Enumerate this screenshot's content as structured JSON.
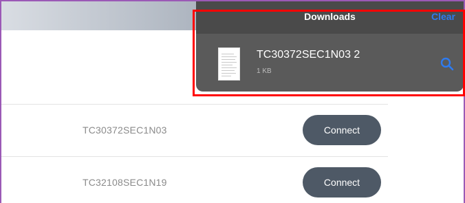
{
  "downloads_panel": {
    "title": "Downloads",
    "clear_label": "Clear",
    "items": [
      {
        "file_name": "TC30372SEC1N03 2",
        "file_size": "1 KB",
        "icon": "search-icon"
      }
    ]
  },
  "devices": [
    {
      "name": "TC30372SEC1N03",
      "action_label": "Connect"
    },
    {
      "name": "TC32108SEC1N19",
      "action_label": "Connect"
    }
  ],
  "colors": {
    "accent": "#2e7bf0",
    "button": "#4e5966",
    "highlight": "#ff0000",
    "popup_bg": "#5a5a5a"
  }
}
